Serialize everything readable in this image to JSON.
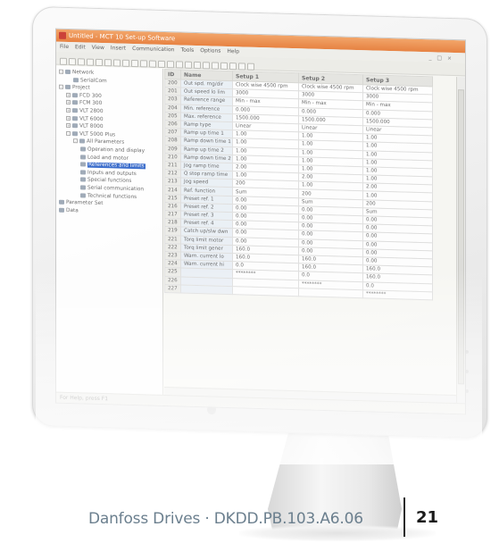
{
  "app": {
    "title": "Untitled - MCT 10 Set-up Software",
    "menu": [
      "File",
      "Edit",
      "View",
      "Insert",
      "Communication",
      "Tools",
      "Options",
      "Help"
    ],
    "window_controls": "_ □ ×",
    "status": "For Help, press F1"
  },
  "tree": [
    {
      "label": "Network",
      "depth": 0,
      "toggle": "-",
      "icon": "network-icon"
    },
    {
      "label": "SerialCom",
      "depth": 2,
      "toggle": "",
      "icon": "serial-icon"
    },
    {
      "label": "Project",
      "depth": 0,
      "toggle": "-",
      "icon": "project-icon"
    },
    {
      "label": "FCD 300",
      "depth": 1,
      "toggle": "+",
      "icon": "drive-icon"
    },
    {
      "label": "FCM 300",
      "depth": 1,
      "toggle": "+",
      "icon": "drive-icon"
    },
    {
      "label": "VLT 2800",
      "depth": 1,
      "toggle": "+",
      "icon": "drive-icon"
    },
    {
      "label": "VLT 6000",
      "depth": 1,
      "toggle": "+",
      "icon": "drive-icon"
    },
    {
      "label": "VLT 8000",
      "depth": 1,
      "toggle": "+",
      "icon": "drive-icon"
    },
    {
      "label": "VLT 5000 Plus",
      "depth": 1,
      "toggle": "-",
      "icon": "drive-icon"
    },
    {
      "label": "All Parameters",
      "depth": 2,
      "toggle": "-",
      "icon": "folder-icon"
    },
    {
      "label": "Operation and display",
      "depth": 3,
      "toggle": "",
      "icon": "param-group-icon"
    },
    {
      "label": "Load and motor",
      "depth": 3,
      "toggle": "",
      "icon": "param-group-icon"
    },
    {
      "label": "References and limits",
      "depth": 3,
      "toggle": "",
      "icon": "param-group-icon",
      "selected": true
    },
    {
      "label": "Inputs and outputs",
      "depth": 3,
      "toggle": "",
      "icon": "param-group-icon"
    },
    {
      "label": "Special functions",
      "depth": 3,
      "toggle": "",
      "icon": "param-group-icon"
    },
    {
      "label": "Serial communication",
      "depth": 3,
      "toggle": "",
      "icon": "param-group-icon"
    },
    {
      "label": "Technical functions",
      "depth": 3,
      "toggle": "",
      "icon": "param-group-icon"
    },
    {
      "label": "Parameter Set",
      "depth": 0,
      "toggle": "",
      "icon": "param-set-icon"
    },
    {
      "label": "Data",
      "depth": 0,
      "toggle": "",
      "icon": "data-icon"
    }
  ],
  "table": {
    "headers": [
      "ID",
      "Name",
      "Setup 1",
      "Setup 2",
      "Setup 3"
    ],
    "rows": [
      [
        "200",
        "Out spd. rng/dir",
        "Clock wise 4500 rpm",
        "Clock wise 4500 rpm",
        "Clock wise 4500 rpm"
      ],
      [
        "201",
        "Out speed lo lim",
        "3000",
        "3000",
        "3000"
      ],
      [
        "203",
        "Reference range",
        "Min - max",
        "Min - max",
        "Min - max"
      ],
      [
        "204",
        "Min. reference",
        "0.000",
        "0.000",
        "0.000"
      ],
      [
        "205",
        "Max. reference",
        "1500.000",
        "1500.000",
        "1500.000"
      ],
      [
        "206",
        "Ramp type",
        "Linear",
        "Linear",
        "Linear"
      ],
      [
        "207",
        "Ramp up time 1",
        "1.00",
        "1.00",
        "1.00"
      ],
      [
        "208",
        "Ramp down time 1",
        "1.00",
        "1.00",
        "1.00"
      ],
      [
        "209",
        "Ramp up time 2",
        "1.00",
        "1.00",
        "1.00"
      ],
      [
        "210",
        "Ramp down time 2",
        "1.00",
        "1.00",
        "1.00"
      ],
      [
        "211",
        "Jog ramp time",
        "2.00",
        "1.00",
        "1.00"
      ],
      [
        "212",
        "Q stop ramp time",
        "1.00",
        "2.00",
        "1.00"
      ],
      [
        "213",
        "Jog speed",
        "200",
        "1.00",
        "2.00"
      ],
      [
        "214",
        "Ref. function",
        "Sum",
        "200",
        "1.00"
      ],
      [
        "215",
        "Preset ref. 1",
        "0.00",
        "Sum",
        "200"
      ],
      [
        "216",
        "Preset ref. 2",
        "0.00",
        "0.00",
        "Sum"
      ],
      [
        "217",
        "Preset ref. 3",
        "0.00",
        "0.00",
        "0.00"
      ],
      [
        "218",
        "Preset ref. 4",
        "0.00",
        "0.00",
        "0.00"
      ],
      [
        "219",
        "Catch up/slw dwn",
        "0.00",
        "0.00",
        "0.00"
      ],
      [
        "221",
        "Torq limit motor",
        "0.00",
        "0.00",
        "0.00"
      ],
      [
        "222",
        "Torq limit gener",
        "160.0",
        "0.00",
        "0.00"
      ],
      [
        "223",
        "Warn. current lo",
        "160.0",
        "160.0",
        "0.00"
      ],
      [
        "224",
        "Warn. current hi",
        "0.0",
        "160.0",
        "160.0"
      ],
      [
        "225",
        "",
        "********",
        "0.0",
        "160.0"
      ],
      [
        "226",
        "",
        "",
        "********",
        "0.0"
      ],
      [
        "227",
        "",
        "",
        "",
        "********"
      ]
    ]
  },
  "footer": {
    "publication": "Danfoss Drives · DKDD.PB.103.A6.06",
    "page_number": "21"
  }
}
